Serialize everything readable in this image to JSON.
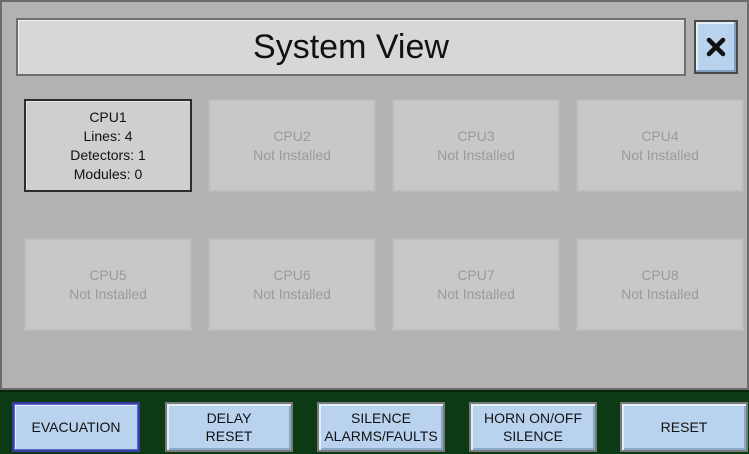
{
  "window": {
    "title": "System View",
    "close_icon": "close-x-icon"
  },
  "cpus": [
    {
      "name": "CPU1",
      "lines": "Lines: 4",
      "detectors": "Detectors: 1",
      "modules": "Modules: 0",
      "installed": true
    },
    {
      "name": "CPU2",
      "status": "Not Installed",
      "installed": false
    },
    {
      "name": "CPU3",
      "status": "Not Installed",
      "installed": false
    },
    {
      "name": "CPU4",
      "status": "Not Installed",
      "installed": false
    },
    {
      "name": "CPU5",
      "status": "Not Installed",
      "installed": false
    },
    {
      "name": "CPU6",
      "status": "Not Installed",
      "installed": false
    },
    {
      "name": "CPU7",
      "status": "Not Installed",
      "installed": false
    },
    {
      "name": "CPU8",
      "status": "Not Installed",
      "installed": false
    }
  ],
  "actions": {
    "evacuation": {
      "line1": "EVACUATION"
    },
    "delay_reset": {
      "line1": "DELAY",
      "line2": "RESET"
    },
    "silence_alarms": {
      "line1": "SILENCE",
      "line2": "ALARMS/FAULTS"
    },
    "horn_silence": {
      "line1": "HORN ON/OFF",
      "line2": "SILENCE"
    },
    "reset": {
      "line1": "RESET"
    }
  },
  "colors": {
    "button_blue": "#b9d3ef",
    "bottom_bar_green": "#0c3a14",
    "panel_gray": "#b2b2b2"
  }
}
